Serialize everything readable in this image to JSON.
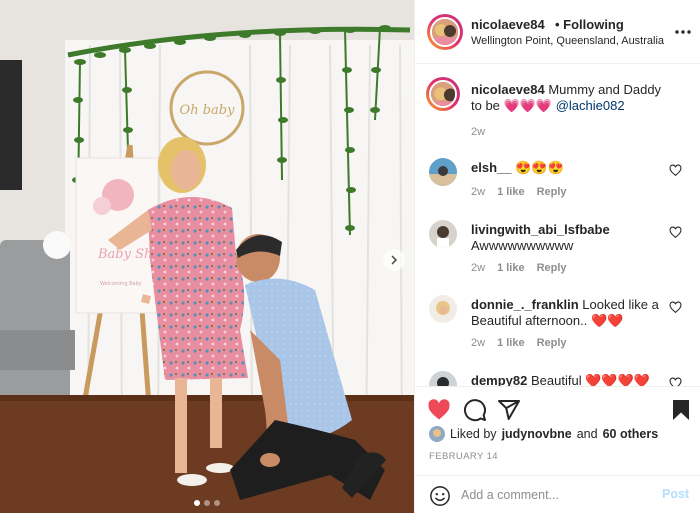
{
  "post": {
    "username": "nicolaeve84",
    "following_label": "• Following",
    "location": "Wellington Point, Queensland, Australia",
    "caption": {
      "username": "nicolaeve84",
      "text": "Mummy and Daddy to be 💗💗💗",
      "mention": "@lachie082",
      "time": "2w"
    },
    "sign_text": "Baby Sh",
    "sign_subtext": "Welcoming Baby",
    "backdrop_text": "Oh baby"
  },
  "comments": [
    {
      "username": "elsh__",
      "text": "😍😍😍",
      "time": "2w",
      "likes": "1 like",
      "reply": "Reply"
    },
    {
      "username": "livingwith_abi_lsfbabe",
      "text": "Awwwwwwwwww",
      "time": "2w",
      "likes": "1 like",
      "reply": "Reply"
    },
    {
      "username": "donnie_._franklin",
      "text": "Looked like a Beautiful afternoon.. ❤️❤️",
      "time": "2w",
      "likes": "1 like",
      "reply": "Reply"
    },
    {
      "username": "dempy82",
      "text": "Beautiful ❤️❤️❤️❤️"
    }
  ],
  "likes": {
    "prefix": "Liked by",
    "user": "judynovbne",
    "connector": "and",
    "others": "60 others"
  },
  "date": "FEBRUARY 14",
  "add_comment": {
    "placeholder": "Add a comment...",
    "post_label": "Post"
  },
  "carousel": {
    "slides": 3,
    "active": 1
  },
  "colors": {
    "accent": "#ed4956",
    "link": "#00376b",
    "muted": "#8e8e8e",
    "post_disabled": "#b2dffc"
  },
  "icons": [
    "more-icon",
    "heart-icon",
    "comment-icon",
    "share-icon",
    "bookmark-icon",
    "emoji-icon",
    "chevron-right-icon"
  ]
}
